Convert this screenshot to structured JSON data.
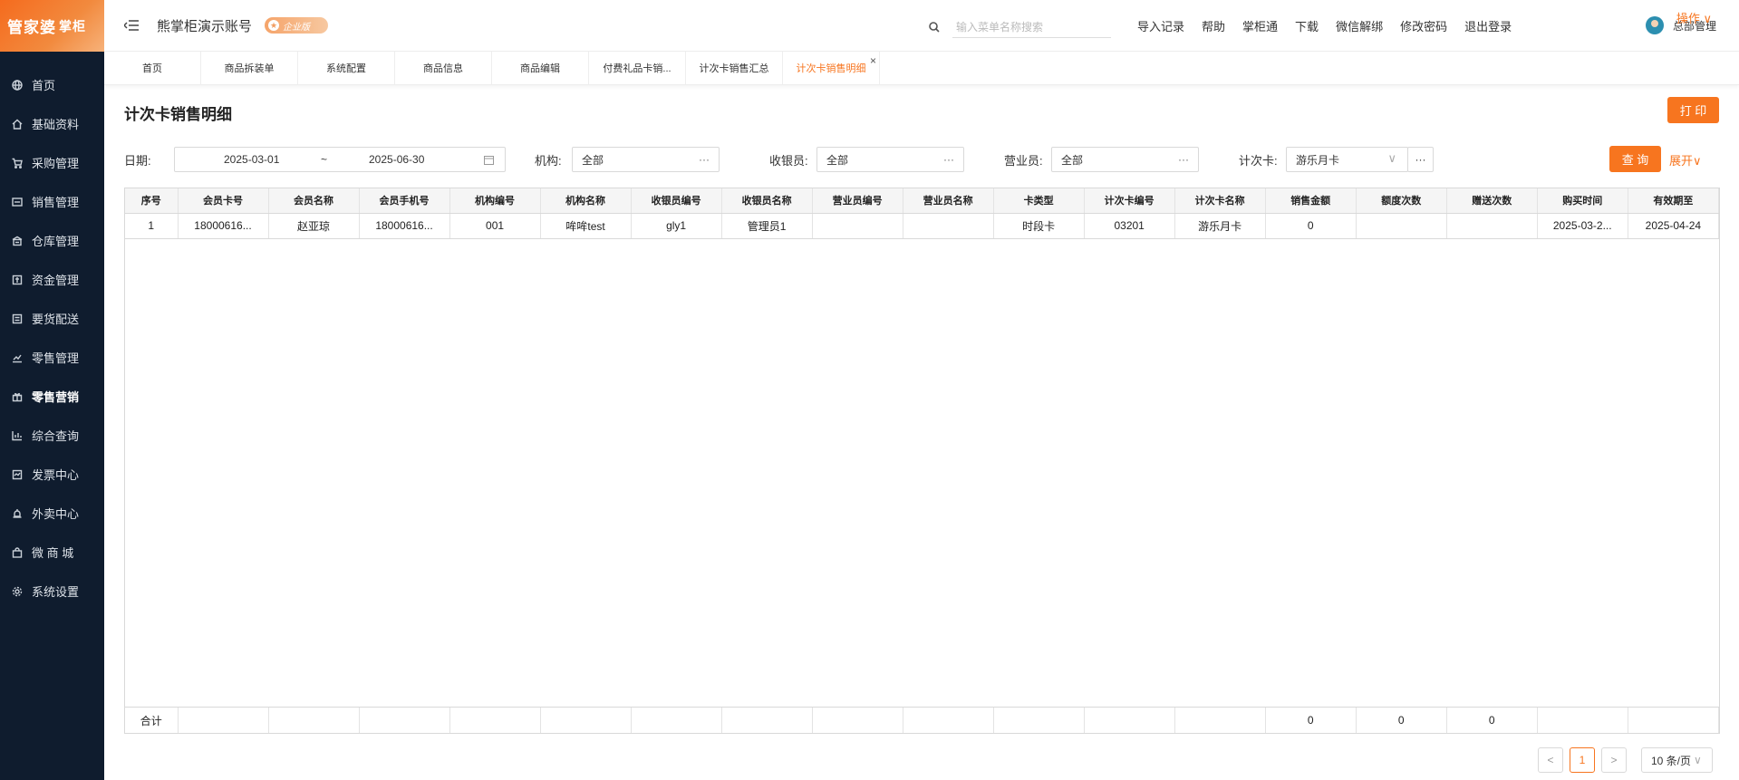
{
  "brand": {
    "name": "管家婆",
    "sub": "掌柜"
  },
  "sidebar": {
    "items": [
      {
        "label": "首页",
        "icon": "globe-icon"
      },
      {
        "label": "基础资料",
        "icon": "home-icon"
      },
      {
        "label": "采购管理",
        "icon": "cart-icon"
      },
      {
        "label": "销售管理",
        "icon": "sales-icon"
      },
      {
        "label": "仓库管理",
        "icon": "warehouse-icon"
      },
      {
        "label": "资金管理",
        "icon": "money-icon"
      },
      {
        "label": "要货配送",
        "icon": "delivery-icon"
      },
      {
        "label": "零售管理",
        "icon": "chart-icon"
      },
      {
        "label": "零售营销",
        "icon": "gift-icon"
      },
      {
        "label": "综合查询",
        "icon": "bar-chart-icon"
      },
      {
        "label": "发票中心",
        "icon": "invoice-icon"
      },
      {
        "label": "外卖中心",
        "icon": "alarm-icon"
      },
      {
        "label": "微 商 城",
        "icon": "shop-bag-icon"
      },
      {
        "label": "系统设置",
        "icon": "gear-icon"
      }
    ],
    "active_index": 8
  },
  "header": {
    "account": "熊掌柜演示账号",
    "badge": "企业版",
    "search_placeholder": "输入菜单名称搜索",
    "links": [
      "导入记录",
      "帮助",
      "掌柜通",
      "下载",
      "微信解绑",
      "修改密码",
      "退出登录"
    ],
    "user": "总部管理"
  },
  "tabs": {
    "items": [
      "首页",
      "商品拆装单",
      "系统配置",
      "商品信息",
      "商品编辑",
      "付费礼品卡销...",
      "计次卡销售汇总",
      "计次卡销售明细"
    ],
    "active_index": 7,
    "close": "×",
    "ops": "操作"
  },
  "page": {
    "title": "计次卡销售明细",
    "print": "打 印"
  },
  "filters": {
    "date_label": "日期:",
    "date_start": "2025-03-01",
    "date_sep": "~",
    "date_end": "2025-06-30",
    "org_label": "机构:",
    "org_value": "全部",
    "cashier_label": "收银员:",
    "cashier_value": "全部",
    "sales_label": "营业员:",
    "sales_value": "全部",
    "card_label": "计次卡:",
    "card_value": "游乐月卡",
    "more": "···",
    "query": "查 询",
    "expand": "展开"
  },
  "table": {
    "columns": [
      "序号",
      "会员卡号",
      "会员名称",
      "会员手机号",
      "机构编号",
      "机构名称",
      "收银员编号",
      "收银员名称",
      "营业员编号",
      "营业员名称",
      "卡类型",
      "计次卡编号",
      "计次卡名称",
      "销售金额",
      "额度次数",
      "赠送次数",
      "购买时间",
      "有效期至"
    ],
    "rows": [
      [
        "1",
        "18000616...",
        "赵亚琼",
        "18000616...",
        "001",
        "哞哞test",
        "gly1",
        "管理员1",
        "",
        "",
        "时段卡",
        "03201",
        "游乐月卡",
        "0",
        "",
        "",
        "2025-03-2...",
        "2025-04-24"
      ]
    ],
    "totals": [
      "合计",
      "",
      "",
      "",
      "",
      "",
      "",
      "",
      "",
      "",
      "",
      "",
      "",
      "0",
      "0",
      "0",
      "",
      ""
    ]
  },
  "pagination": {
    "prev": "<",
    "current": "1",
    "next": ">",
    "page_size": "10 条/页"
  },
  "colors": {
    "accent": "#f7751f",
    "sidebar": "#0f1c2e"
  }
}
